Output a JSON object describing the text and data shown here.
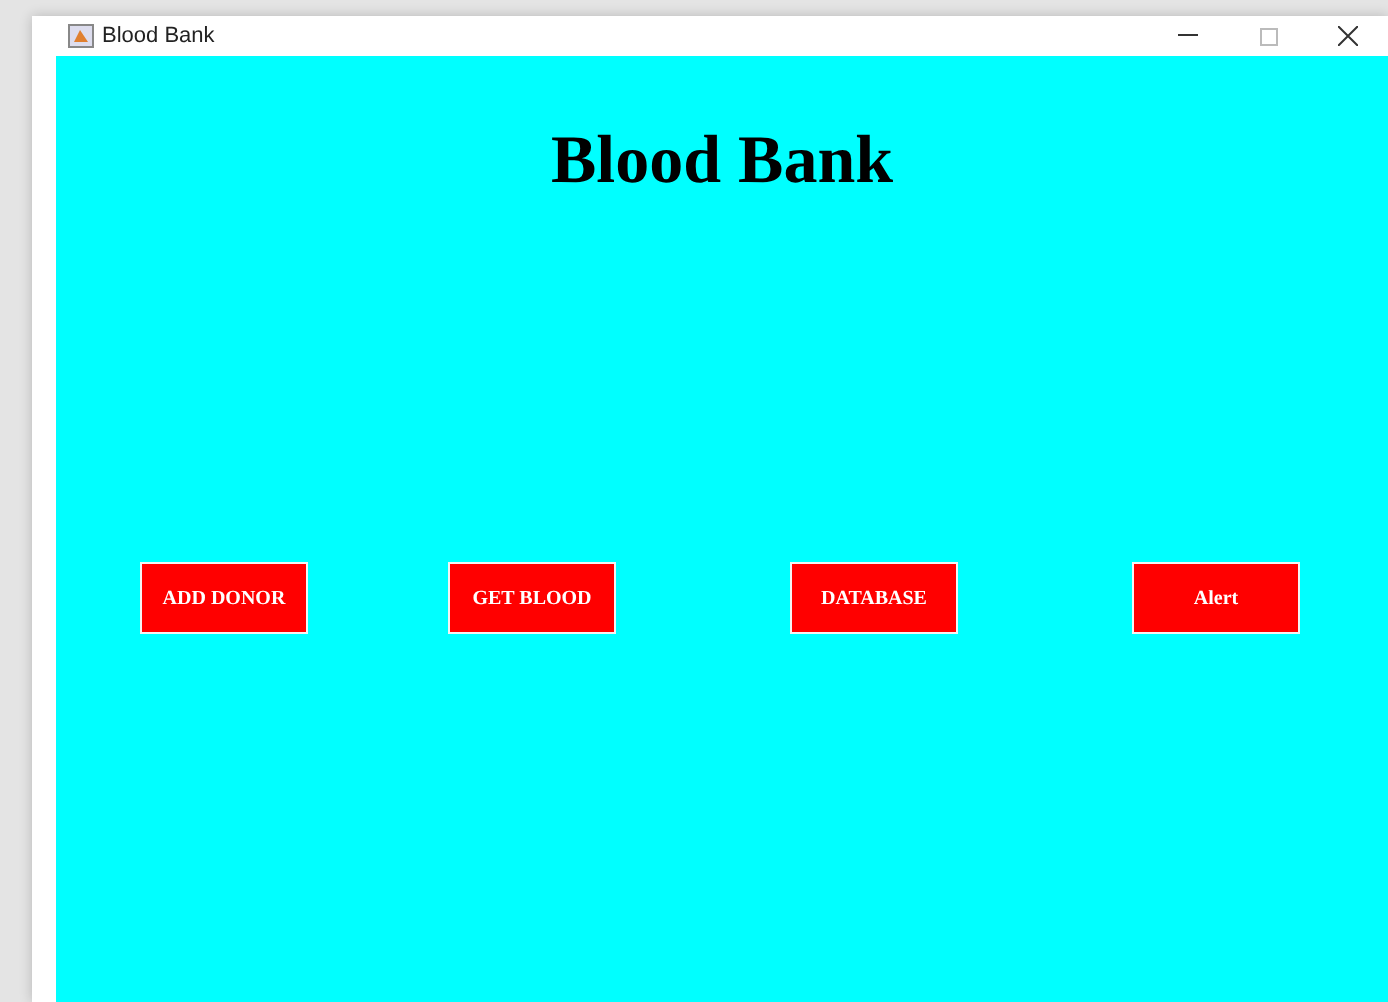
{
  "window": {
    "title": "Blood Bank"
  },
  "heading": "Blood Bank",
  "buttons": [
    "ADD DONOR",
    "GET BLOOD",
    "DATABASE",
    "Alert"
  ]
}
